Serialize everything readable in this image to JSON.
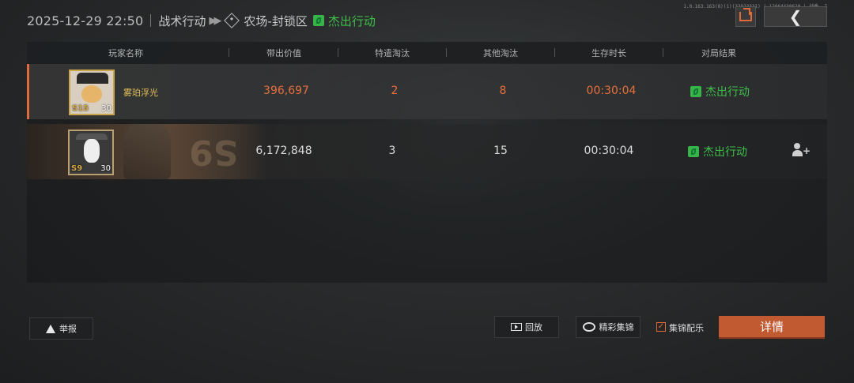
{
  "header": {
    "datetime": "2025-12-29 22:50",
    "mode": "战术行动",
    "map": "农场-封锁区",
    "result": "杰出行动"
  },
  "version_text": "1.0.163.163(8)(1)(22923331) | 12664430620 | 战季 -7",
  "table": {
    "columns": [
      "玩家名称",
      "带出价值",
      "特遣淘汰",
      "其他淘汰",
      "生存时长",
      "对局结果"
    ],
    "rows": [
      {
        "name": "雾珀浮光",
        "level": "30",
        "season_tag": "S15",
        "value": "396,697",
        "special_kills": "2",
        "other_kills": "8",
        "survival_time": "00:30:04",
        "result": "杰出行动",
        "highlight": true
      },
      {
        "name": "",
        "level": "30",
        "season_tag": "S9",
        "banner_text": "S9",
        "value": "6,172,848",
        "special_kills": "3",
        "other_kills": "15",
        "survival_time": "00:30:04",
        "result": "杰出行动",
        "highlight": false
      }
    ]
  },
  "buttons": {
    "report": "举报",
    "replay": "回放",
    "highlights": "精彩集锦",
    "highlight_music": "集锦配乐",
    "details": "详情"
  },
  "highlight_music_checked": true,
  "colors": {
    "accent": "#c25a31",
    "success": "#3fbf4a",
    "highlight_text": "#e6703c"
  }
}
